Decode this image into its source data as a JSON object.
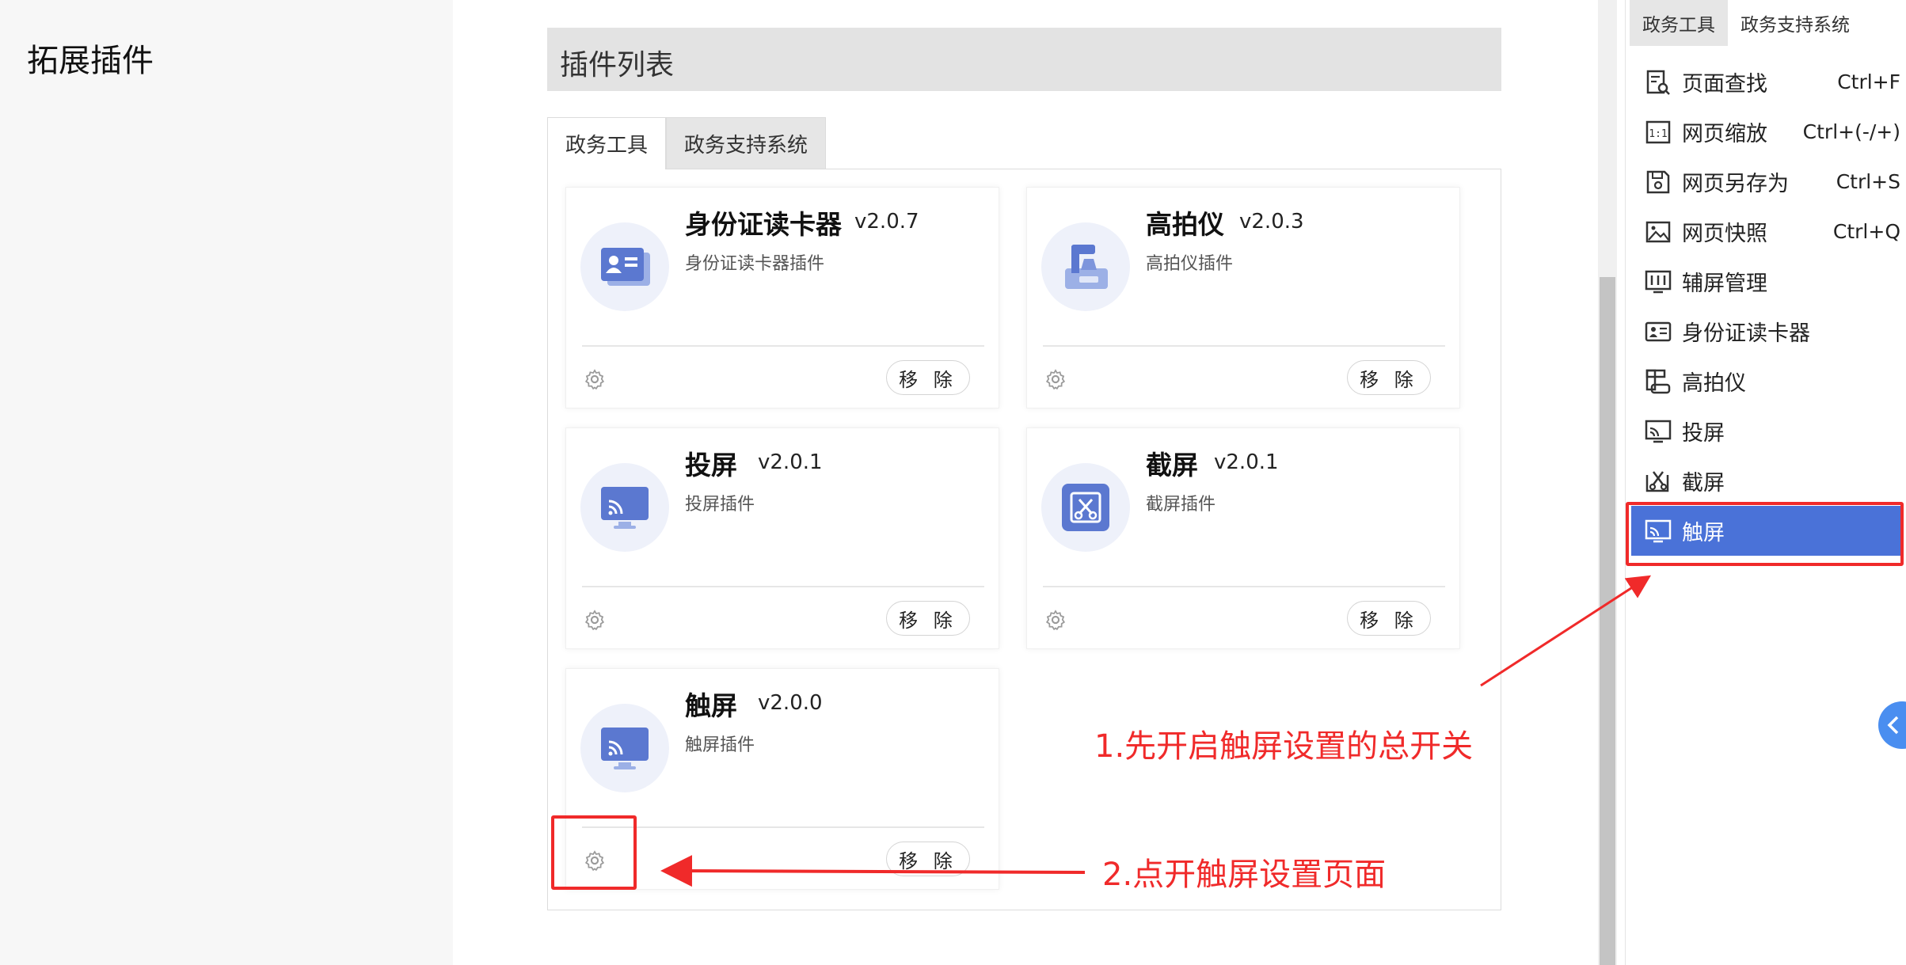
{
  "page": {
    "title": "拓展插件"
  },
  "plugin_list": {
    "header": "插件列表",
    "tabs": [
      {
        "label": "政务工具",
        "active": true
      },
      {
        "label": "政务支持系统",
        "active": false
      }
    ],
    "remove_label": "移 除",
    "cards": [
      {
        "name": "身份证读卡器",
        "version": "v2.0.7",
        "desc": "身份证读卡器插件",
        "icon": "id-card-icon"
      },
      {
        "name": "高拍仪",
        "version": "v2.0.3",
        "desc": "高拍仪插件",
        "icon": "document-camera-icon"
      },
      {
        "name": "投屏",
        "version": "v2.0.1",
        "desc": "投屏插件",
        "icon": "cast-screen-icon"
      },
      {
        "name": "截屏",
        "version": "v2.0.1",
        "desc": "截屏插件",
        "icon": "screenshot-icon"
      },
      {
        "name": "触屏",
        "version": "v2.0.0",
        "desc": "触屏插件",
        "icon": "touch-screen-icon"
      }
    ]
  },
  "right_panel": {
    "tabs": [
      {
        "label": "政务工具",
        "active": true
      },
      {
        "label": "政务支持系统",
        "active": false
      }
    ],
    "menu": [
      {
        "label": "页面查找",
        "shortcut": "Ctrl+F",
        "icon": "page-search-icon"
      },
      {
        "label": "网页缩放",
        "shortcut": "Ctrl+(-/+)",
        "icon": "zoom-icon"
      },
      {
        "label": "网页另存为",
        "shortcut": "Ctrl+S",
        "icon": "save-icon"
      },
      {
        "label": "网页快照",
        "shortcut": "Ctrl+Q",
        "icon": "snapshot-icon"
      },
      {
        "label": "辅屏管理",
        "shortcut": "",
        "icon": "secondary-screen-icon"
      },
      {
        "label": "身份证读卡器",
        "shortcut": "",
        "icon": "id-card-icon"
      },
      {
        "label": "高拍仪",
        "shortcut": "",
        "icon": "document-camera-icon"
      },
      {
        "label": "投屏",
        "shortcut": "",
        "icon": "cast-screen-icon"
      },
      {
        "label": "截屏",
        "shortcut": "",
        "icon": "screenshot-icon"
      },
      {
        "label": "触屏",
        "shortcut": "",
        "icon": "touch-screen-icon",
        "active": true
      }
    ]
  },
  "annotations": {
    "step1": "1.先开启触屏设置的总开关",
    "step2": "2.点开触屏设置页面",
    "color": "#f02a2a"
  },
  "colors": {
    "accent": "#4a72d8",
    "icon_blue": "#5b78d0",
    "icon_bg": "#eef1fa"
  }
}
